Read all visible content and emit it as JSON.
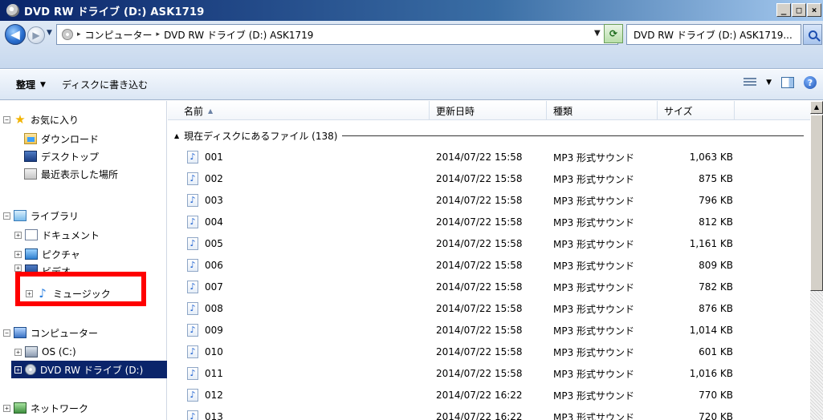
{
  "window": {
    "title": "DVD RW ドライブ (D:) ASK1719",
    "minimize_label": "_",
    "maximize_label": "□",
    "close_label": "×"
  },
  "address": {
    "crumbs": [
      "コンピューター",
      "DVD RW ドライブ (D:) ASK1719"
    ],
    "crumb_separator": "▸",
    "search_placeholder": "DVD RW ドライブ (D:) ASK1719..."
  },
  "commandbar": {
    "organize_label": "整理",
    "dropdown_glyph": "▼",
    "burn_label": "ディスクに書き込む",
    "help_glyph": "?"
  },
  "nav": {
    "favorites_label": "お気に入り",
    "downloads_label": "ダウンロード",
    "desktop_label": "デスクトップ",
    "recent_label": "最近表示した場所",
    "libraries_label": "ライブラリ",
    "documents_label": "ドキュメント",
    "pictures_label": "ピクチャ",
    "videos_label": "ビデオ",
    "music_label": "ミュージック",
    "computer_label": "コンピューター",
    "os_drive_label": "OS (C:)",
    "dvd_drive_label": "DVD RW ドライブ (D:)",
    "network_label": "ネットワーク"
  },
  "filelist": {
    "columns": {
      "name": "名前",
      "date": "更新日時",
      "type": "種類",
      "size": "サイズ"
    },
    "group_label": "現在ディスクにあるファイル (138)",
    "rows": [
      {
        "name": "001",
        "date": "2014/07/22 15:58",
        "type": "MP3 形式サウンド",
        "size": "1,063 KB"
      },
      {
        "name": "002",
        "date": "2014/07/22 15:58",
        "type": "MP3 形式サウンド",
        "size": "875 KB"
      },
      {
        "name": "003",
        "date": "2014/07/22 15:58",
        "type": "MP3 形式サウンド",
        "size": "796 KB"
      },
      {
        "name": "004",
        "date": "2014/07/22 15:58",
        "type": "MP3 形式サウンド",
        "size": "812 KB"
      },
      {
        "name": "005",
        "date": "2014/07/22 15:58",
        "type": "MP3 形式サウンド",
        "size": "1,161 KB"
      },
      {
        "name": "006",
        "date": "2014/07/22 15:58",
        "type": "MP3 形式サウンド",
        "size": "809 KB"
      },
      {
        "name": "007",
        "date": "2014/07/22 15:58",
        "type": "MP3 形式サウンド",
        "size": "782 KB"
      },
      {
        "name": "008",
        "date": "2014/07/22 15:58",
        "type": "MP3 形式サウンド",
        "size": "876 KB"
      },
      {
        "name": "009",
        "date": "2014/07/22 15:58",
        "type": "MP3 形式サウンド",
        "size": "1,014 KB"
      },
      {
        "name": "010",
        "date": "2014/07/22 15:58",
        "type": "MP3 形式サウンド",
        "size": "601 KB"
      },
      {
        "name": "011",
        "date": "2014/07/22 15:58",
        "type": "MP3 形式サウンド",
        "size": "1,016 KB"
      },
      {
        "name": "012",
        "date": "2014/07/22 16:22",
        "type": "MP3 形式サウンド",
        "size": "770 KB"
      },
      {
        "name": "013",
        "date": "2014/07/22 16:22",
        "type": "MP3 形式サウンド",
        "size": "720 KB"
      }
    ]
  },
  "colors": {
    "title_bar": "#0a246a",
    "highlight_box": "#ff0000",
    "selection": "#0a246a"
  }
}
